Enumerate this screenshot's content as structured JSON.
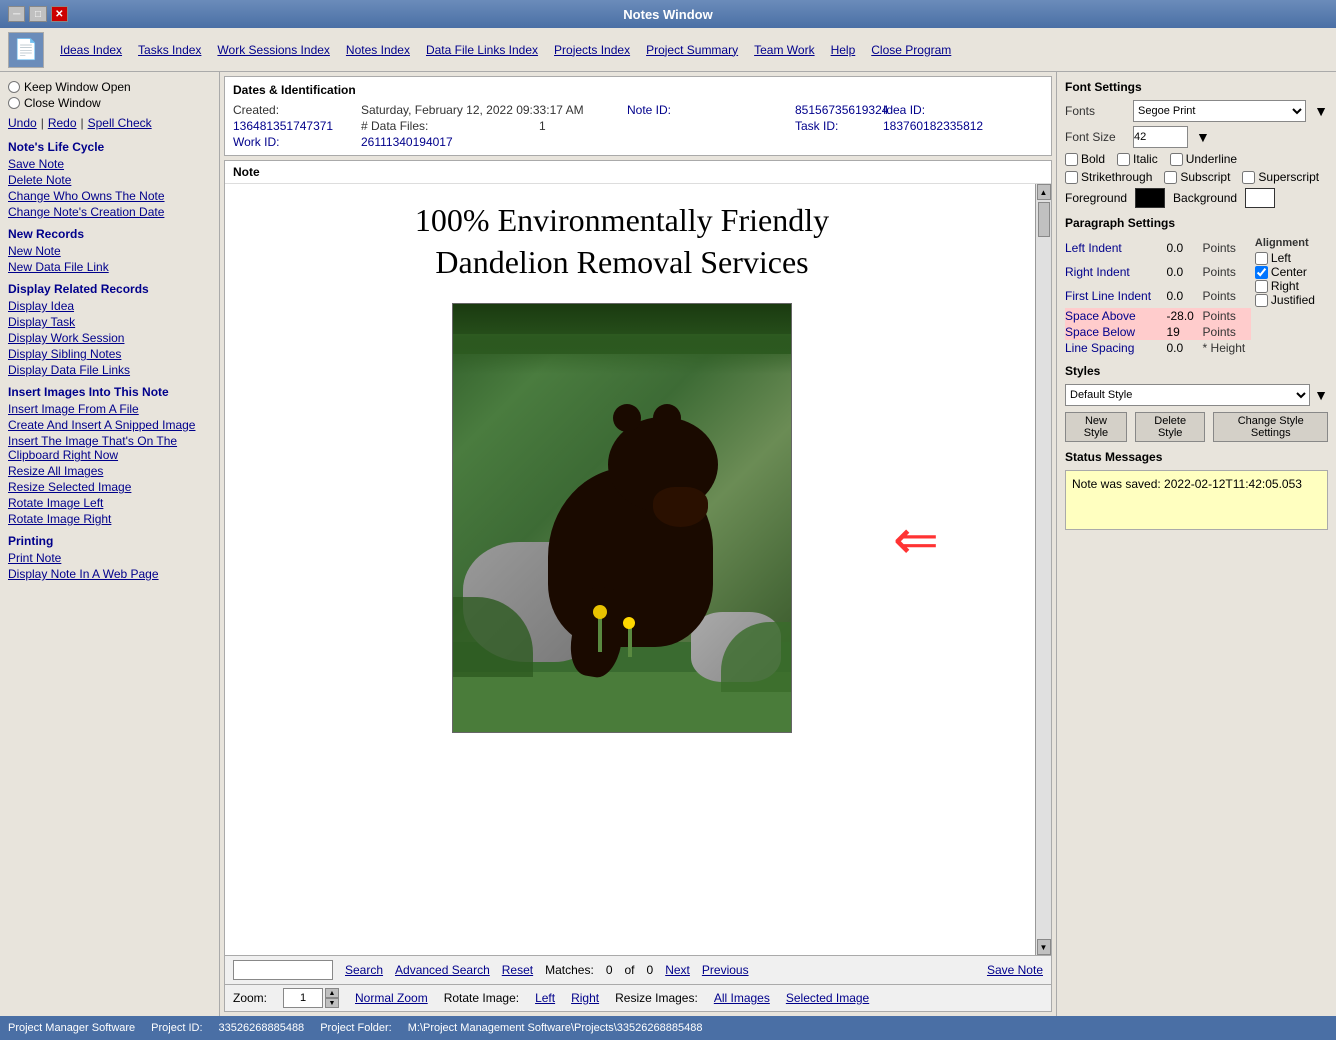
{
  "window": {
    "title": "Notes Window",
    "controls": {
      "minimize": "─",
      "restore": "□",
      "close": "✕"
    }
  },
  "menu": {
    "app_icon": "📄",
    "items": [
      {
        "label": "Ideas Index",
        "id": "ideas-index"
      },
      {
        "label": "Tasks Index",
        "id": "tasks-index"
      },
      {
        "label": "Work Sessions Index",
        "id": "work-sessions-index"
      },
      {
        "label": "Notes Index",
        "id": "notes-index"
      },
      {
        "label": "Data File Links Index",
        "id": "data-file-links-index"
      },
      {
        "label": "Projects Index",
        "id": "projects-index"
      },
      {
        "label": "Project Summary",
        "id": "project-summary"
      },
      {
        "label": "Team Work",
        "id": "team-work"
      },
      {
        "label": "Help",
        "id": "help"
      },
      {
        "label": "Close Program",
        "id": "close-program"
      }
    ]
  },
  "sidebar": {
    "keep_window_open": "Keep Window Open",
    "close_window": "Close Window",
    "undo": "Undo",
    "redo": "Redo",
    "spell_check": "Spell Check",
    "lifecycle_title": "Note's Life Cycle",
    "lifecycle_items": [
      {
        "label": "Save Note"
      },
      {
        "label": "Delete Note"
      },
      {
        "label": "Change Who Owns The Note"
      },
      {
        "label": "Change Note's Creation Date"
      }
    ],
    "new_records_title": "New Records",
    "new_records_items": [
      {
        "label": "New Note"
      },
      {
        "label": "New Data File Link"
      }
    ],
    "display_related_title": "Display Related Records",
    "display_related_items": [
      {
        "label": "Display Idea"
      },
      {
        "label": "Display Task"
      },
      {
        "label": "Display Work Session"
      },
      {
        "label": "Display Sibling Notes"
      },
      {
        "label": "Display Data File Links"
      }
    ],
    "insert_images_title": "Insert Images Into This Note",
    "insert_images_items": [
      {
        "label": "Insert Image From A File"
      },
      {
        "label": "Create And Insert A Snipped Image"
      },
      {
        "label": "Insert The Image That's On The Clipboard Right Now"
      },
      {
        "label": "Resize All Images"
      },
      {
        "label": "Resize Selected Image"
      },
      {
        "label": "Rotate Image Left"
      },
      {
        "label": "Rotate Image Right"
      }
    ],
    "printing_title": "Printing",
    "printing_items": [
      {
        "label": "Print Note"
      },
      {
        "label": "Display Note In A Web Page"
      }
    ]
  },
  "dates": {
    "section_title": "Dates & Identification",
    "created_label": "Created:",
    "created_value": "Saturday, February 12, 2022   09:33:17 AM",
    "data_files_label": "# Data Files:",
    "data_files_value": "1",
    "note_id_label": "Note ID:",
    "note_id_value": "85156735619324",
    "idea_id_label": "Idea ID:",
    "idea_id_value": "136481351747371",
    "task_id_label": "Task ID:",
    "task_id_value": "183760182335812",
    "work_id_label": "Work ID:",
    "work_id_value": "26111340194017"
  },
  "note": {
    "section_title": "Note",
    "title_line1": "100% Environmentally Friendly",
    "title_line2": "Dandelion Removal Services"
  },
  "search_bar": {
    "search_label": "Search",
    "advanced_search_label": "Advanced Search",
    "reset_label": "Reset",
    "matches_label": "Matches:",
    "matches_count": "0",
    "of_label": "of",
    "total_matches": "0",
    "next_label": "Next",
    "previous_label": "Previous",
    "save_note_label": "Save Note"
  },
  "zoom_bar": {
    "zoom_label": "Zoom:",
    "zoom_value": "1",
    "normal_zoom_label": "Normal Zoom",
    "rotate_image_label": "Rotate Image:",
    "left_label": "Left",
    "right_label": "Right",
    "resize_images_label": "Resize Images:",
    "all_images_label": "All Images",
    "selected_image_label": "Selected Image"
  },
  "font_settings": {
    "title": "Font Settings",
    "fonts_label": "Fonts",
    "fonts_value": "Segoe Print",
    "font_size_label": "Font Size",
    "font_size_value": "42",
    "bold_label": "Bold",
    "italic_label": "Italic",
    "underline_label": "Underline",
    "strikethrough_label": "Strikethrough",
    "subscript_label": "Subscript",
    "superscript_label": "Superscript",
    "foreground_label": "Foreground",
    "background_label": "Background"
  },
  "paragraph_settings": {
    "title": "Paragraph Settings",
    "left_indent_label": "Left Indent",
    "left_indent_value": "0.0",
    "right_indent_label": "Right Indent",
    "right_indent_value": "0.0",
    "first_line_label": "First Line Indent",
    "first_line_value": "0.0",
    "space_above_label": "Space Above",
    "space_above_value": "-28.0",
    "space_below_label": "Space Below",
    "space_below_value": "19",
    "line_spacing_label": "Line Spacing",
    "line_spacing_value": "0.0",
    "points_label": "Points",
    "height_label": "* Height",
    "alignment_label": "Alignment",
    "left_label": "Left",
    "center_label": "Center",
    "right_label": "Right",
    "justified_label": "Justified"
  },
  "styles": {
    "title": "Styles",
    "current_style": "Default Style",
    "new_style_label": "New Style",
    "delete_style_label": "Delete Style",
    "change_style_label": "Change Style Settings"
  },
  "status_messages": {
    "title": "Status Messages",
    "message": "Note was saved:  2022-02-12T11:42:05.053"
  },
  "status_bar": {
    "software": "Project Manager Software",
    "project_id_label": "Project ID:",
    "project_id_value": "33526268885488",
    "project_folder_label": "Project Folder:",
    "project_folder_value": "M:\\Project Management Software\\Projects\\33526268885488"
  }
}
